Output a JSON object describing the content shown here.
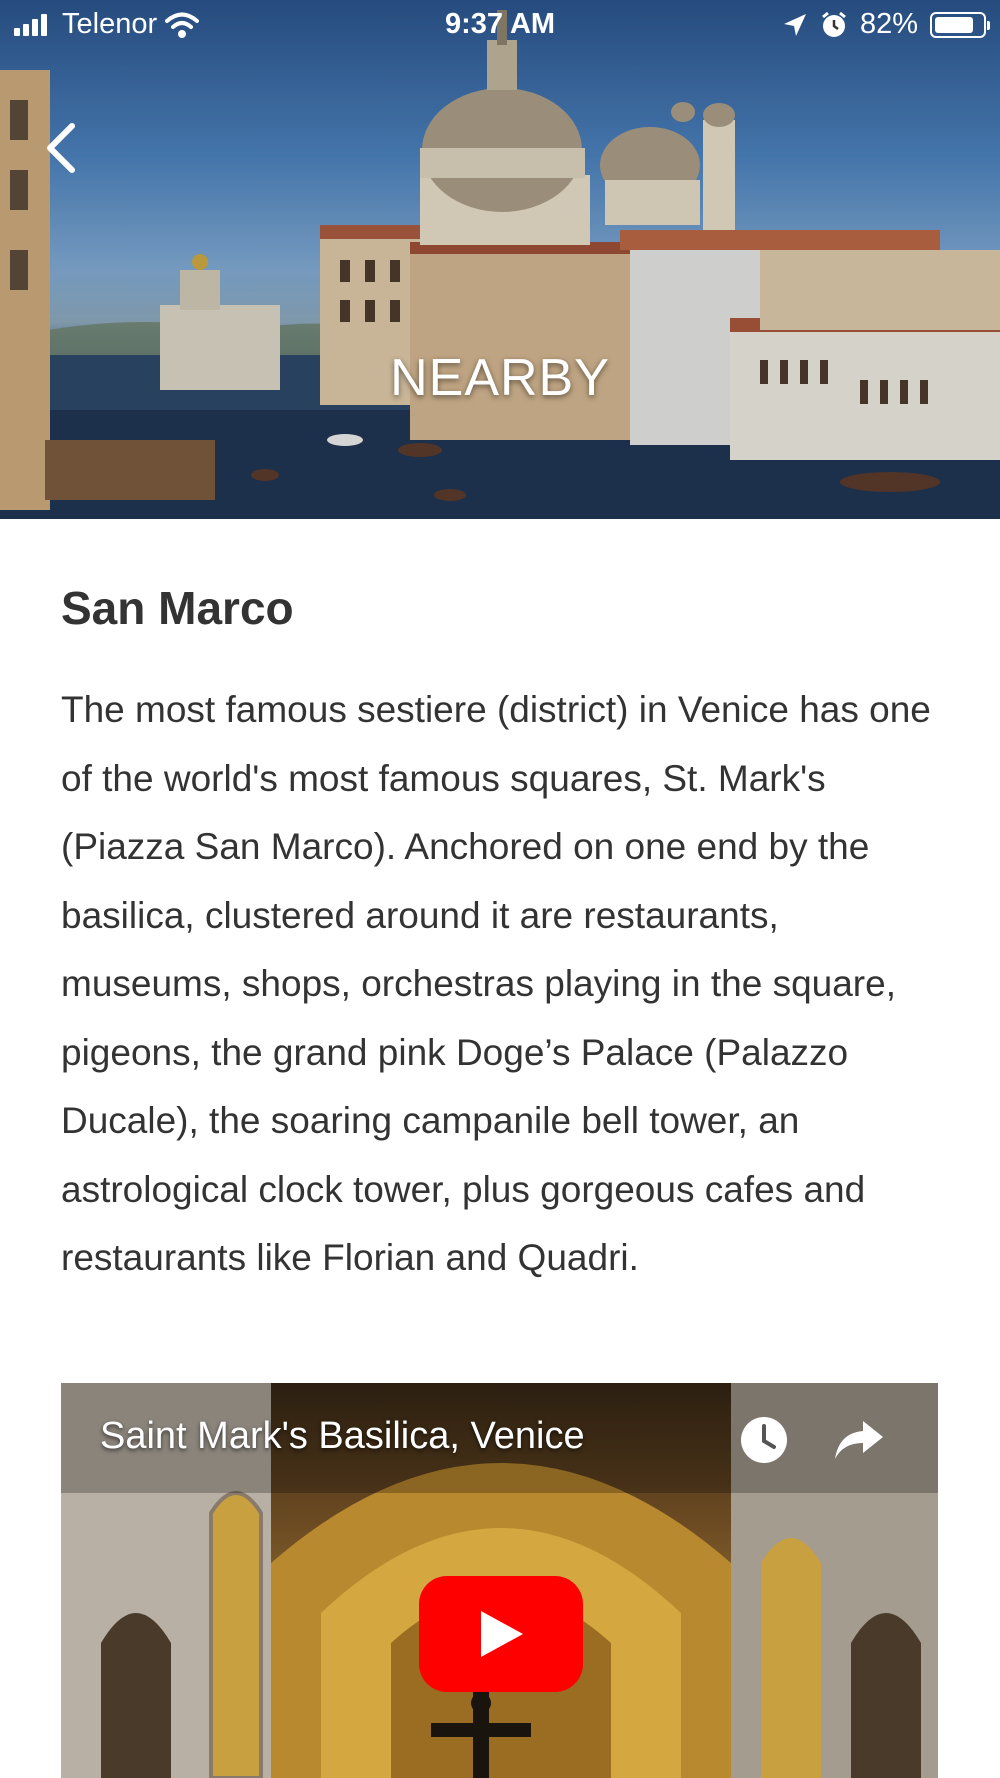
{
  "status_bar": {
    "carrier": "Telenor",
    "time": "9:37 AM",
    "battery_percent": "82%",
    "battery_level": 0.82,
    "icons": [
      "signal-icon",
      "wifi-icon",
      "location-arrow-icon",
      "alarm-icon",
      "battery-icon"
    ]
  },
  "header": {
    "title": "NEARBY",
    "back_icon": "chevron-left-icon"
  },
  "section": {
    "title": "San Marco",
    "description": "The most famous sestiere (district) in Venice has one of the world's most famous squares, St. Mark's (Piazza San Marco). Anchored on one end by the basilica, clustered around it are restaurants, museums, shops, orchestras playing in the square, pigeons, the grand pink Doge’s Palace (Palazzo Ducale), the soaring campanile bell tower, an astrological clock tower, plus gorgeous cafes and restaurants like Florian and Quadri."
  },
  "video": {
    "title": "Saint Mark's Basilica, Venice",
    "icons": [
      "clock-icon",
      "share-icon",
      "play-icon"
    ],
    "play_button_color": "#ff0000"
  }
}
